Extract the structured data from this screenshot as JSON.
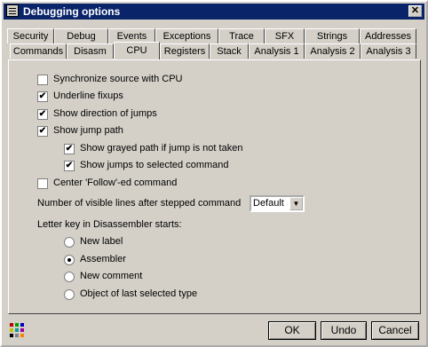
{
  "window": {
    "title": "Debugging options",
    "close_glyph": "✕"
  },
  "tabs_row1": [
    "Security",
    "Debug",
    "Events",
    "Exceptions",
    "Trace",
    "SFX",
    "Strings",
    "Addresses"
  ],
  "tabs_row2": [
    "Commands",
    "Disasm",
    "CPU",
    "Registers",
    "Stack",
    "Analysis 1",
    "Analysis 2",
    "Analysis 3"
  ],
  "active_tab": "CPU",
  "options": {
    "sync_source": {
      "label": "Synchronize source with CPU",
      "checked": false
    },
    "underline_fixups": {
      "label": "Underline fixups",
      "checked": true
    },
    "show_direction": {
      "label": "Show direction of jumps",
      "checked": true
    },
    "show_jump_path": {
      "label": "Show jump path",
      "checked": true
    },
    "show_grayed_path": {
      "label": "Show grayed path if jump is not taken",
      "checked": true
    },
    "show_jumps_selected": {
      "label": "Show jumps to selected command",
      "checked": true
    },
    "center_follow": {
      "label": "Center 'Follow'-ed command",
      "checked": false
    }
  },
  "visible_lines": {
    "label": "Number of visible lines after stepped command",
    "value": "Default"
  },
  "letter_key": {
    "label": "Letter key in Disassembler starts:",
    "options": [
      "New label",
      "Assembler",
      "New comment",
      "Object of last selected type"
    ],
    "selected": 1
  },
  "buttons": {
    "ok": "OK",
    "undo": "Undo",
    "cancel": "Cancel"
  },
  "check_glyph": "✔"
}
